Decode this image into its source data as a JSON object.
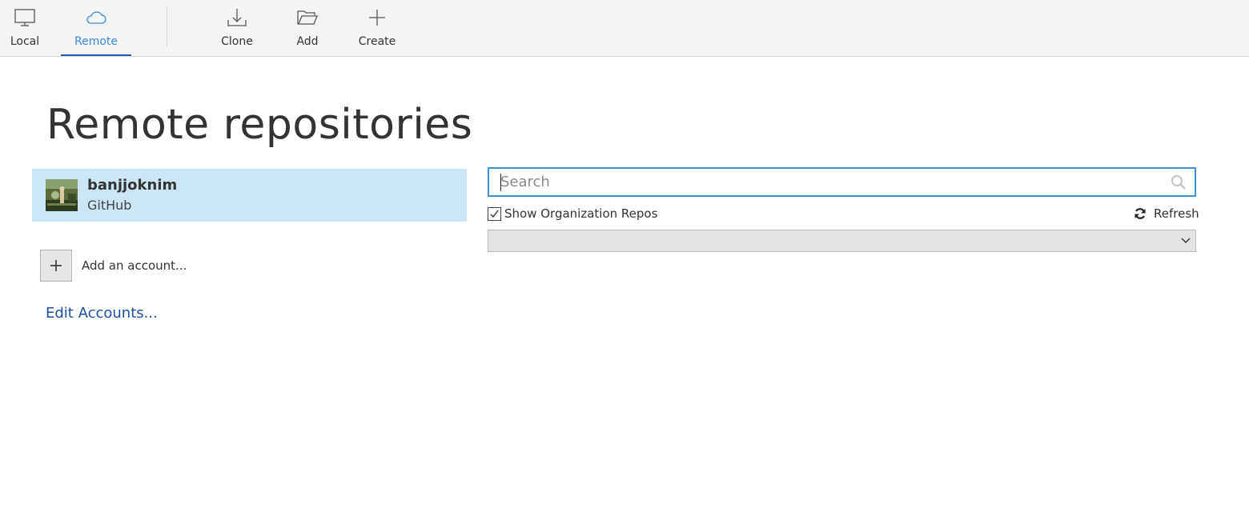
{
  "toolbar": {
    "local_label": "Local",
    "remote_label": "Remote",
    "clone_label": "Clone",
    "add_label": "Add",
    "create_label": "Create",
    "active_tab": "Remote"
  },
  "page": {
    "title": "Remote repositories"
  },
  "accounts": [
    {
      "name": "banjjoknim",
      "provider": "GitHub",
      "selected": true
    }
  ],
  "add_account": {
    "label": "Add an account..."
  },
  "edit_accounts": {
    "label": "Edit Accounts..."
  },
  "search": {
    "value": "",
    "placeholder": "Search"
  },
  "options": {
    "show_org_repos_label": "Show Organization Repos",
    "show_org_repos_checked": true,
    "refresh_label": "Refresh"
  },
  "repo_dropdown": {
    "selected": ""
  },
  "colors": {
    "accent": "#3b8ad8",
    "selection": "#cce6f6",
    "link": "#1c4ea3"
  }
}
